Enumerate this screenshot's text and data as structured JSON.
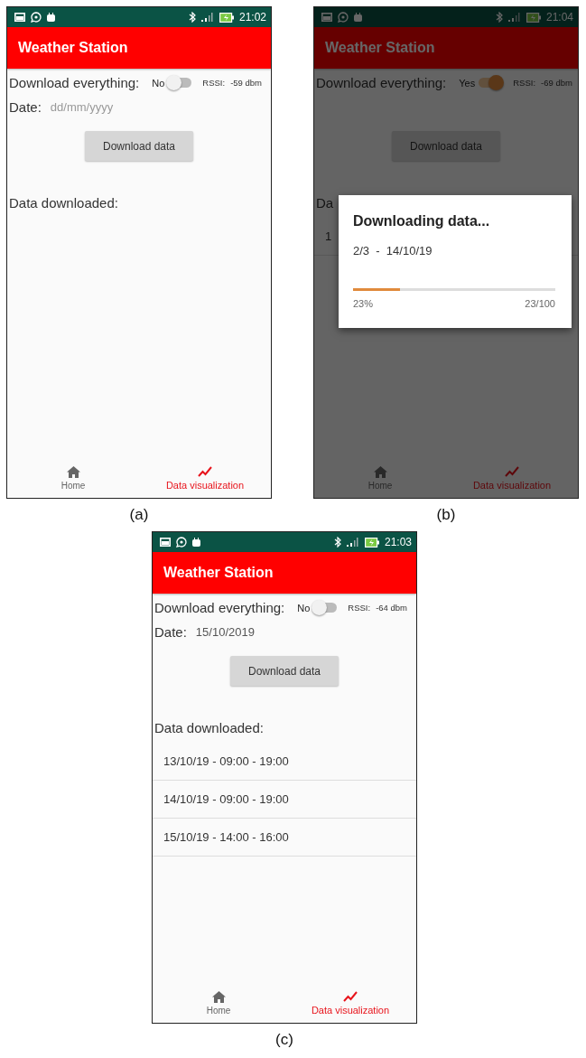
{
  "screens": [
    {
      "caption": "(a)",
      "status_bar": {
        "time": "21:02"
      },
      "app_title": "Weather Station",
      "download_everything": {
        "label": "Download everything:",
        "value_text": "No",
        "on": false
      },
      "rssi": {
        "label": "RSSI:",
        "value": "-59 dbm"
      },
      "date": {
        "label": "Date:",
        "placeholder": "dd/mm/yyyy"
      },
      "button": "Download data",
      "data_label": "Data downloaded:",
      "nav": [
        {
          "label": "Home",
          "selected": false
        },
        {
          "label": "Data visualization",
          "selected": true
        }
      ]
    },
    {
      "caption": "(b)",
      "status_bar": {
        "time": "21:04"
      },
      "app_title": "Weather Station",
      "download_everything": {
        "label": "Download everything:",
        "value_text": "Yes",
        "on": true
      },
      "rssi": {
        "label": "RSSI:",
        "value": "-69 dbm"
      },
      "button": "Download data",
      "data_label": "Da",
      "items": [
        {
          "text": "1"
        }
      ],
      "nav": [
        {
          "label": "Home",
          "selected": false
        },
        {
          "label": "Data visualization",
          "selected": true
        }
      ],
      "dialog": {
        "title": "Downloading data...",
        "subtitle": "2/3  -  14/10/19",
        "level": 0.23,
        "percent": "23%",
        "count": "23/100"
      }
    },
    {
      "caption": "(c)",
      "status_bar": {
        "time": "21:03"
      },
      "app_title": "Weather Station",
      "download_everything": {
        "label": "Download everything:",
        "value_text": "No",
        "on": false
      },
      "rssi": {
        "label": "RSSI:",
        "value": "-64 dbm"
      },
      "date": {
        "label": "Date:",
        "value": "15/10/2019"
      },
      "button": "Download data",
      "data_label": "Data downloaded:",
      "items": [
        {
          "text": "13/10/19 - 09:00 - 19:00"
        },
        {
          "text": "14/10/19 - 09:00 - 19:00"
        },
        {
          "text": "15/10/19 - 14:00 - 16:00"
        }
      ],
      "nav": [
        {
          "label": "Home",
          "selected": false
        },
        {
          "label": "Data visualization",
          "selected": true
        }
      ]
    }
  ]
}
